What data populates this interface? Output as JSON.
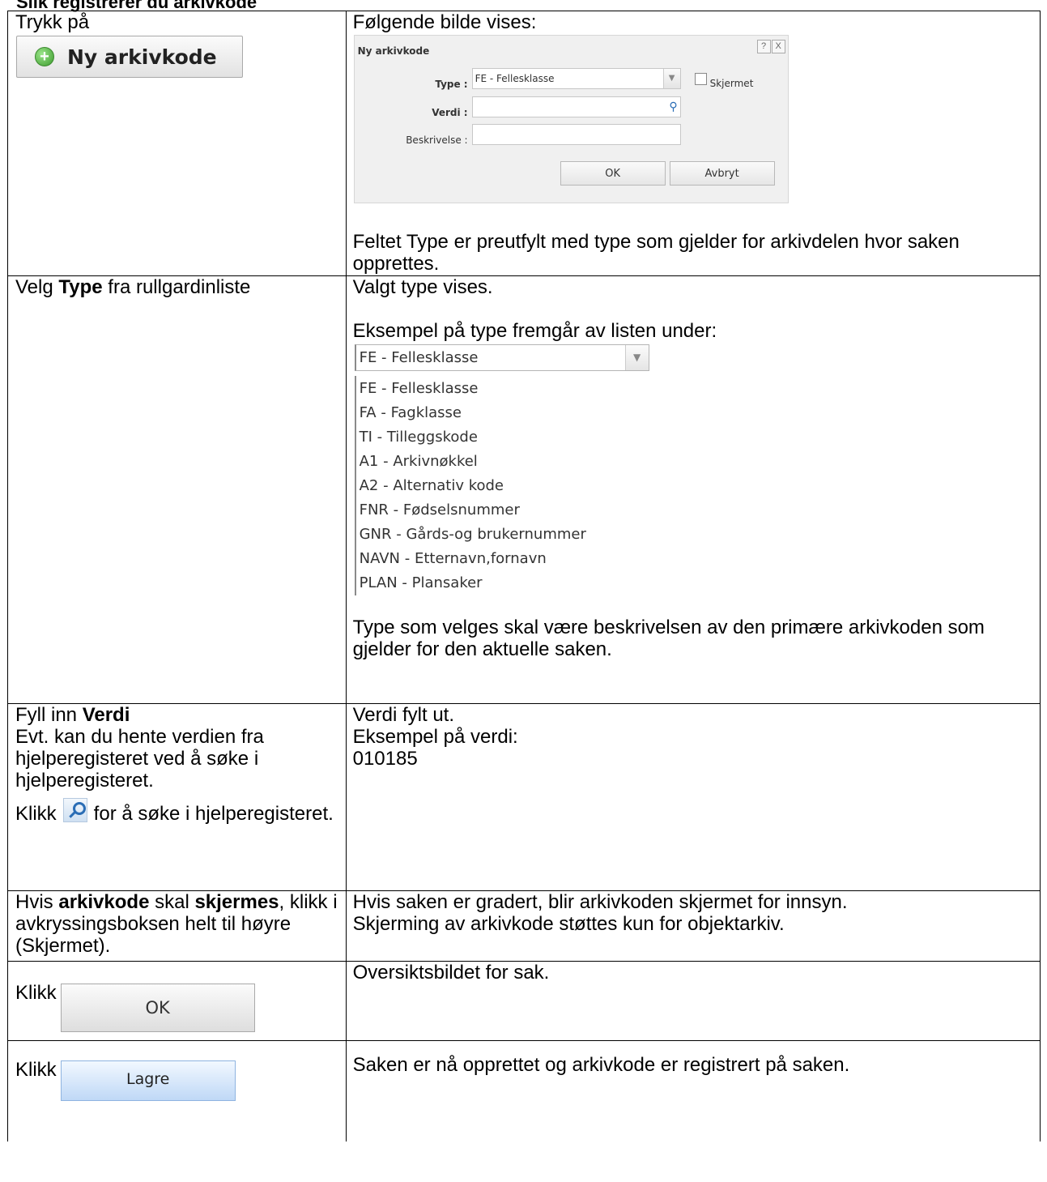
{
  "header": "Slik registrerer du arkivkode",
  "rows": [
    {
      "left": {
        "text": "Trykk på",
        "button": "Ny arkivkode"
      },
      "right": {
        "intro": "Følgende bilde vises:",
        "dialog": {
          "title": "Ny arkivkode",
          "help": "?",
          "close": "X",
          "type_label": "Type :",
          "type_value": "FE - Fellesklasse",
          "skjermet_label": "Skjermet",
          "verdi_label": "Verdi :",
          "beskrivelse_label": "Beskrivelse :",
          "ok": "OK",
          "avbryt": "Avbryt"
        },
        "note": "Feltet Type er preutfylt med type som gjelder for arkivdelen hvor saken opprettes."
      }
    },
    {
      "left": {
        "pre": "Velg ",
        "bold": "Type",
        "post": " fra rullgardinliste"
      },
      "right": {
        "line1": "Valgt type vises.",
        "line2": "Eksempel på type fremgår av listen under:",
        "selected": "FE - Fellesklasse",
        "options": [
          "FE - Fellesklasse",
          "FA - Fagklasse",
          "TI - Tilleggskode",
          "A1 - Arkivnøkkel",
          "A2 - Alternativ kode",
          "FNR - Fødselsnummer",
          "GNR - Gårds-og brukernummer",
          "NAVN - Etternavn,fornavn",
          "PLAN - Plansaker"
        ],
        "note": "Type som velges skal være beskrivelsen av den primære arkivkoden som gjelder for den aktuelle saken."
      }
    },
    {
      "left": {
        "pre": "Fyll inn ",
        "bold": "Verdi",
        "line2": "Evt. kan du hente verdien fra hjelperegisteret ved å søke i hjelperegisteret.",
        "klikk": "Klikk",
        "after_icon": "for å søke i hjelperegisteret."
      },
      "right": {
        "line1": "Verdi fylt ut.",
        "line2": "Eksempel på verdi:",
        "line3": "010185"
      }
    },
    {
      "left": {
        "pre": "Hvis ",
        "bold1": "arkivkode",
        "mid": " skal ",
        "bold2": "skjermes",
        "post": ", klikk i avkryssingsboksen helt til høyre (Skjermet)."
      },
      "right": {
        "line1": "Hvis saken er gradert, blir arkivkoden skjermet for innsyn.",
        "line2": "Skjerming av arkivkode støttes kun for objektarkiv."
      }
    },
    {
      "left": {
        "klikk": "Klikk",
        "button": "OK"
      },
      "right": {
        "text": "Oversiktsbildet for sak."
      }
    },
    {
      "left": {
        "klikk": "Klikk",
        "button": "Lagre"
      },
      "right": {
        "text": "Saken er nå opprettet og arkivkode er registrert på saken."
      }
    }
  ]
}
